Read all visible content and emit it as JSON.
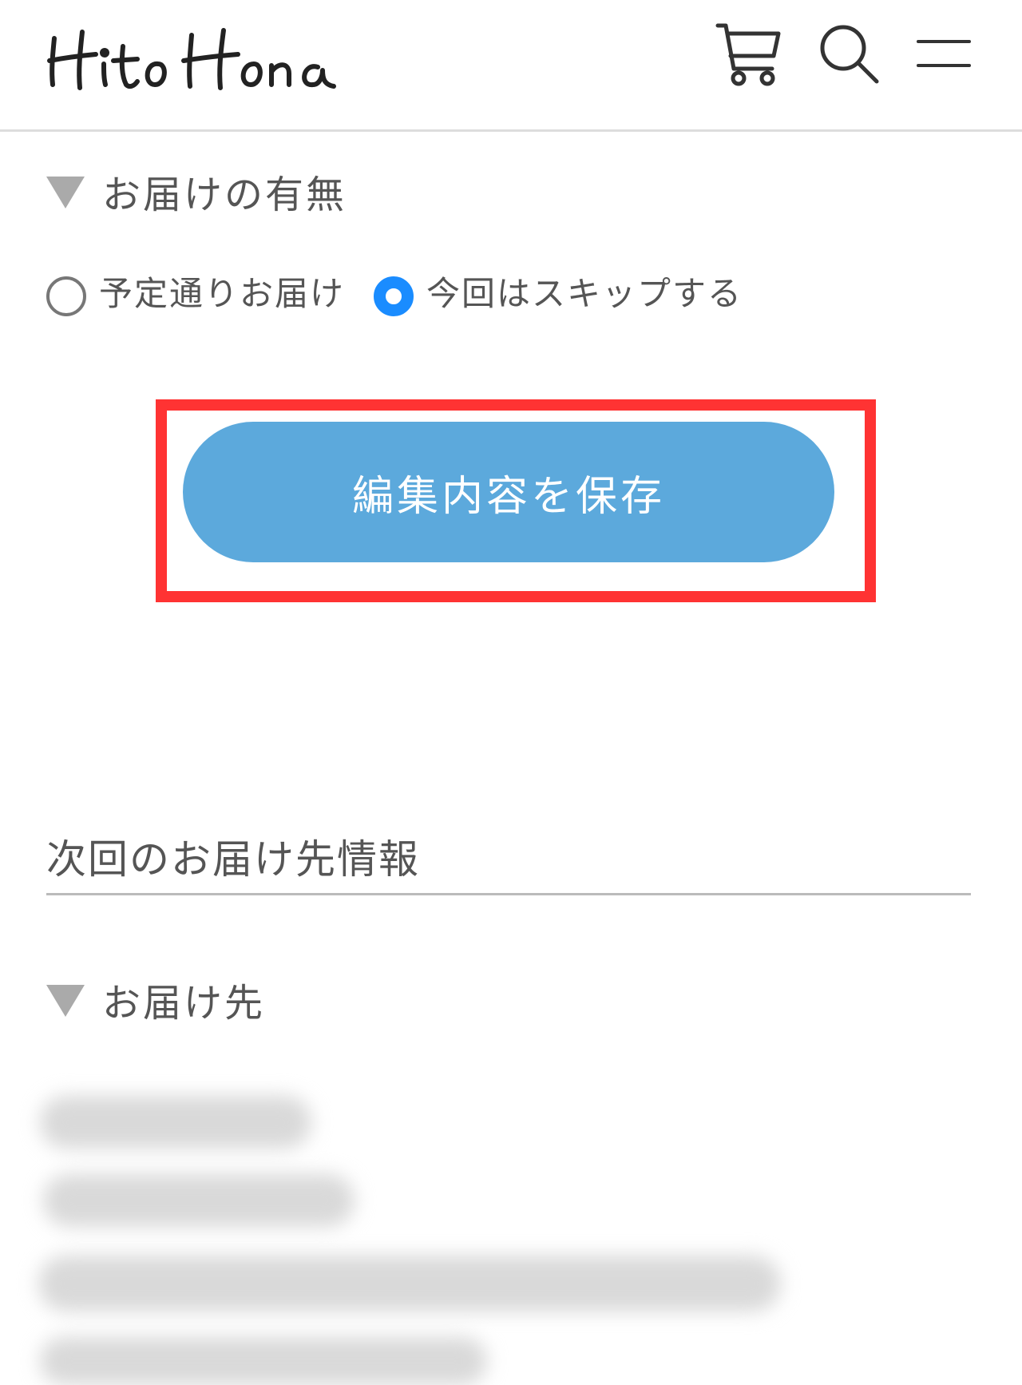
{
  "header": {
    "logo_text": "HitoHana",
    "icons": [
      "cart-icon",
      "search-icon",
      "menu-icon"
    ]
  },
  "delivery_section": {
    "label": "お届けの有無",
    "options": [
      {
        "label": "予定通りお届け",
        "selected": false
      },
      {
        "label": "今回はスキップする",
        "selected": true
      }
    ]
  },
  "save_button": {
    "label": "編集内容を保存"
  },
  "next_delivery": {
    "heading": "次回のお届け先情報",
    "address_label": "お届け先"
  },
  "colors": {
    "accent": "#5ca9dc",
    "radio_selected": "#1a8cff",
    "highlight": "#ff3333",
    "text": "#555555"
  }
}
